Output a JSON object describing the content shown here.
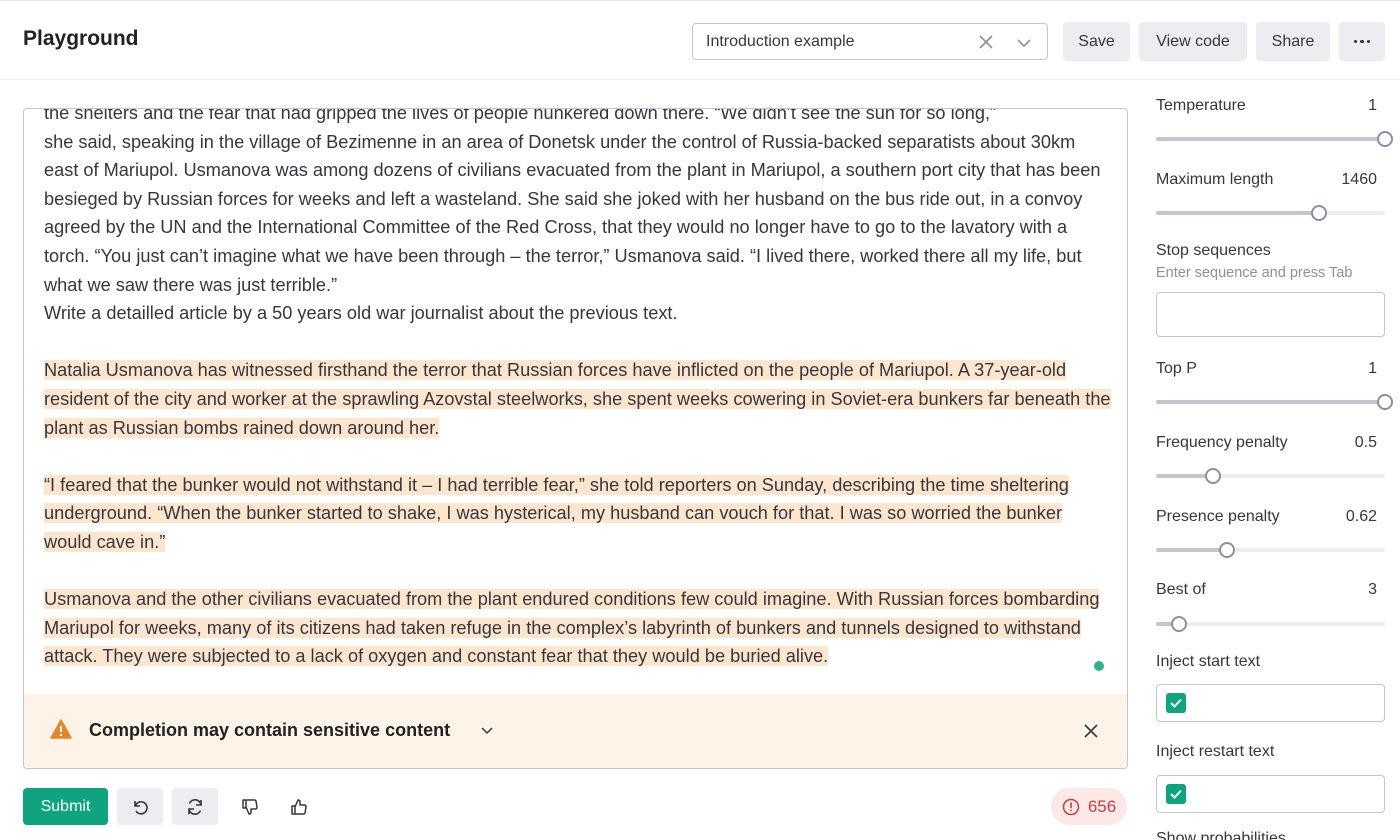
{
  "header": {
    "title": "Playground",
    "preset": "Introduction example",
    "save_label": "Save",
    "view_code_label": "View code",
    "share_label": "Share"
  },
  "editor": {
    "prompt_lines": [
      "the shelters and the fear that had gripped the lives of people hunkered down there. “We didn’t see the sun for so long,”",
      "she said, speaking in the village of Bezimenne in an area of Donetsk under the control of Russia-backed separatists about 30km east of Mariupol. Usmanova was among dozens of civilians evacuated from the plant in Mariupol, a southern port city that has been besieged by Russian forces for weeks and left a wasteland. She said she joked with her husband on the bus ride out, in a convoy agreed by the UN and the International Committee of the Red Cross, that they would no longer have to go to the lavatory with a torch. “You just can’t imagine what we have been through – the terror,” Usmanova said. “I lived there, worked there all my life, but what we saw there was just terrible.”",
      "Write a detailled article by a 50 years old war journalist about the previous text."
    ],
    "completion_paragraphs": [
      "Natalia Usmanova has witnessed firsthand the terror that Russian forces have inflicted on the people of Mariupol. A 37-year-old resident of the city and worker at the sprawling Azovstal steelworks, she spent weeks cowering in Soviet-era bunkers far beneath the plant as Russian bombs rained down around her.",
      "“I feared that the bunker would not withstand it – I had terrible fear,” she told reporters on Sunday, describing the time sheltering underground. “When the bunker started to shake, I was hysterical, my husband can vouch for that. I was so worried the bunker would cave in.”",
      "Usmanova and the other civilians evacuated from the plant endured conditions few could imagine. With Russian forces bombarding Mariupol for weeks, many of its citizens had taken refuge in the complex’s labyrinth of bunkers and tunnels designed to withstand attack. They were subjected to a lack of oxygen and constant fear that they would be buried alive."
    ],
    "warning": "Completion may contain sensitive content"
  },
  "footer": {
    "submit_label": "Submit",
    "token_count": "656"
  },
  "settings": {
    "temperature": {
      "label": "Temperature",
      "value": "1",
      "fraction": 1.0
    },
    "max_length": {
      "label": "Maximum length",
      "value": "1460",
      "fraction": 0.71
    },
    "stop_sequences": {
      "label": "Stop sequences",
      "hint": "Enter sequence and press Tab"
    },
    "top_p": {
      "label": "Top P",
      "value": "1",
      "fraction": 1.0
    },
    "frequency_penalty": {
      "label": "Frequency penalty",
      "value": "0.5",
      "fraction": 0.25
    },
    "presence_penalty": {
      "label": "Presence penalty",
      "value": "0.62",
      "fraction": 0.31
    },
    "best_of": {
      "label": "Best of",
      "value": "3",
      "fraction": 0.1
    },
    "inject_start": {
      "label": "Inject start text",
      "checked": true
    },
    "inject_restart": {
      "label": "Inject restart text",
      "checked": true
    },
    "show_probabilities": {
      "label": "Show probabilities"
    }
  },
  "colors": {
    "accent": "#10a37f",
    "highlight": "#fde6cd",
    "warning_bg": "#fdf4e7",
    "token_badge": "#c53f3f"
  }
}
